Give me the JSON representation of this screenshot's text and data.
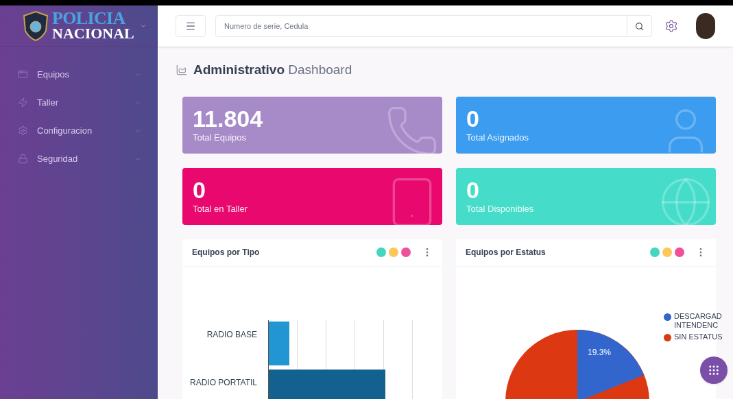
{
  "logo": {
    "line_1": "POLICIA",
    "line_2": "NACIONAL"
  },
  "sidebar": {
    "items": [
      {
        "label": "Equipos"
      },
      {
        "label": "Taller"
      },
      {
        "label": "Configuracion"
      },
      {
        "label": "Seguridad"
      }
    ]
  },
  "header": {
    "search": {
      "placeholder": "Numero de serie, Cedula"
    }
  },
  "page_title": {
    "bold": "Administrativo",
    "rest": "Dashboard"
  },
  "stats": [
    {
      "value": "11.804",
      "label": "Total Equipos",
      "color": "#a78bc9"
    },
    {
      "value": "0",
      "label": "Total Asignados",
      "color": "#3b9cf0"
    },
    {
      "value": "0",
      "label": "Total en Taller",
      "color": "#e8086e"
    },
    {
      "value": "0",
      "label": "Total Disponibles",
      "color": "#45ddc9"
    }
  ],
  "panels": [
    {
      "title": "Equipos por Tipo",
      "kind": "bar",
      "labels": [
        "RADIO BASE",
        "RADIO PORTATIL"
      ]
    },
    {
      "title": "Equipos por Estatus",
      "kind": "pie",
      "slice_label": "19.3%",
      "legend": [
        {
          "label": "DESCARGAD INTENDENC",
          "color": "#3366cc"
        },
        {
          "label": "SIN ESTATUS",
          "color": "#dc3912"
        }
      ]
    }
  ]
}
